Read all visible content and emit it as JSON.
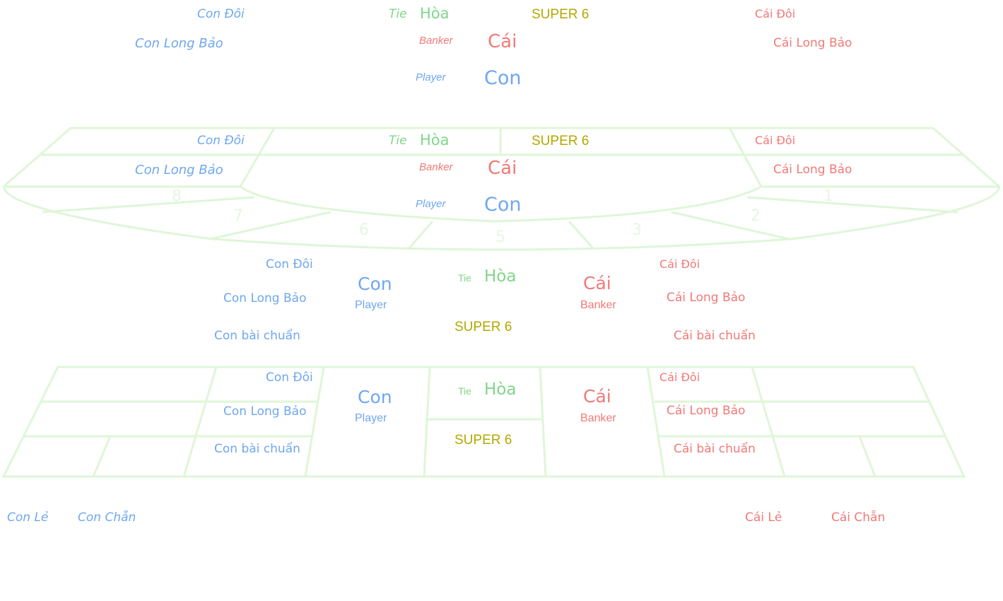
{
  "labels": {
    "player_pair": "Con Đôi",
    "player_dragon": "Con Long Bảo",
    "player_natural": "Con bài chuẩn",
    "player_odd": "Con Lẻ",
    "player_even": "Con Chẵn",
    "banker_pair": "Cái Đôi",
    "banker_dragon": "Cái Long Bảo",
    "banker_natural": "Cái bài chuẩn",
    "banker_odd": "Cái Lẻ",
    "banker_even": "Cái Chẵn",
    "tie_en": "Tie",
    "tie_vi": "Hòa",
    "banker_en": "Banker",
    "banker_vi": "Cái",
    "player_en": "Player",
    "player_vi": "Con",
    "super6": "SUPER 6"
  },
  "table_numbers": [
    "8",
    "7",
    "6",
    "5",
    "3",
    "2",
    "1"
  ],
  "colors": {
    "player": "#6fa7f0",
    "banker": "#f07a78",
    "tie": "#7fd68a",
    "super6": "#b3a800",
    "table_lines": "#dff6d8"
  }
}
